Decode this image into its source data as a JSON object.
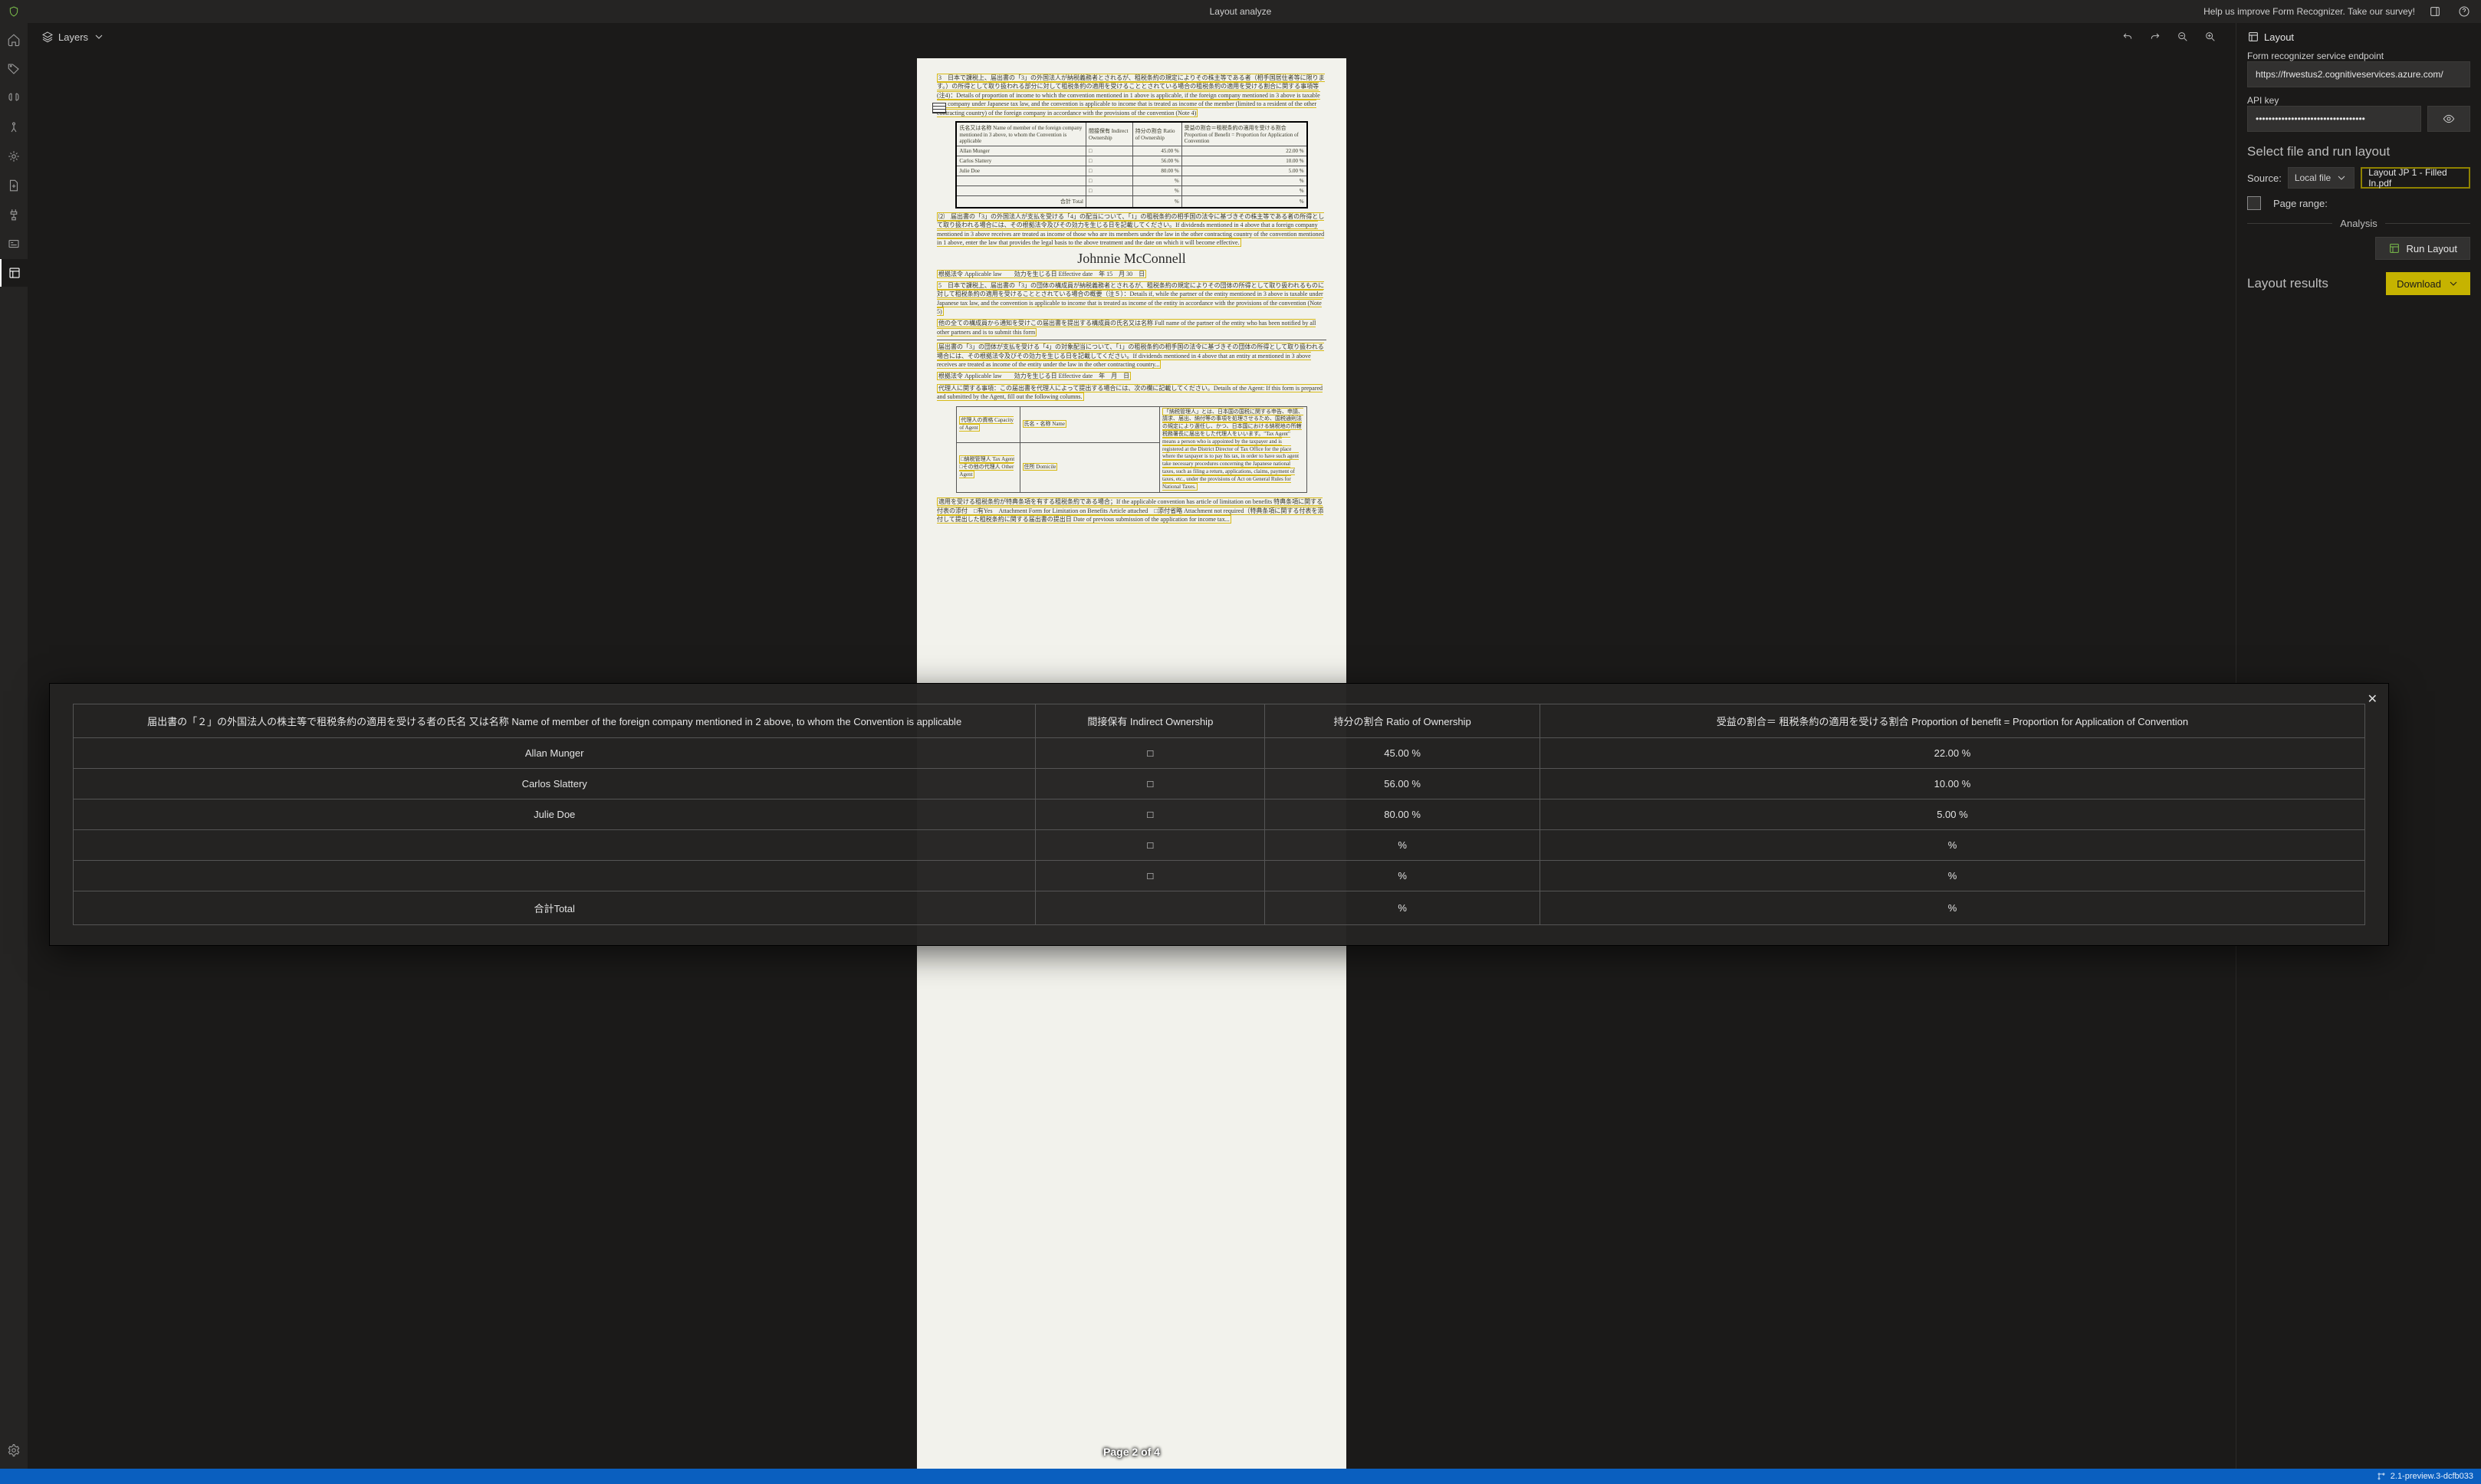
{
  "titlebar": {
    "app_title": "Layout analyze",
    "survey_link": "Help us improve Form Recognizer. Take our survey!"
  },
  "toolbar": {
    "layers_label": "Layers"
  },
  "right_panel": {
    "title": "Layout",
    "endpoint_label": "Form recognizer service endpoint",
    "endpoint_value": "https://frwestus2.cognitiveservices.azure.com/",
    "apikey_label": "API key",
    "apikey_mask": "••••••••••••••••••••••••••••••••••",
    "select_section": "Select file and run layout",
    "source_label": "Source:",
    "source_value": "Local file",
    "file_value": "Layout JP 1 - Filled In.pdf",
    "pagerange_label": "Page range:",
    "analysis_label": "Analysis",
    "run_label": "Run Layout",
    "results_label": "Layout results",
    "download_label": "Download"
  },
  "document": {
    "page_indicator": "Page 2 of 4",
    "signature": "Johnnie McConnell",
    "paragraphs": [
      "3　日本で課税上、届出書の「3」の外国法人が納税義務者とされるが、租税条約の規定によりその株主等である者（相手国居住者等に限ります。）の所得として取り扱われる部分に対して租税条約の適用を受けることとされている場合の租税条約の適用を受ける割合に関する事項等(注4)：Details of proportion of income to which the convention mentioned in 1 above is applicable, if the foreign company mentioned in 3 above is taxable as a company under Japanese tax law, and the convention is applicable to income that is treated as income of the member (limited to a resident of the other contracting country) of the foreign company in accordance with the provisions of the convention (Note 4)",
      "⑵　届出書の「3」の外国法人が支払を受ける「4」の配当について、「1」の租税条約の相手国の法令に基づきその株主等である者の所得として取り扱われる場合には、その根拠法令及びその効力を生じる日を記載してください。If dividends mentioned in 4 above that a foreign company mentioned in 3 above receives are treated as income of those who are its members under the law in the other contracting country of the convention mentioned in 1 above, enter the law that provides the legal basis to the above treatment and the date on which it will become effective.",
      "根拠法令 Applicable law　　効力を生じる日 Effective date　年 15　月 30　日",
      "5　日本で課税上、届出書の「3」の団体の構成員が納税義務者とされるが、租税条約の規定によりその団体の所得として取り扱われるものに対して租税条約の適用を受けることとされている場合の概要（注５）：Details if, while the partner of the entity mentioned in 3 above is taxable under Japanese tax law, and the convention is applicable to income that is treated as income of the entity in accordance with the provisions of the convention (Note 5)",
      "他の全ての構成員から通知を受けこの届出書を提出する構成員の氏名又は名称 Full name of the partner of the entity who has been notified by all other partners and is to submit this form",
      "届出書の「3」の団体が支払を受ける「4」の対象配当について、「1」の租税条約の相手国の法令に基づきその団体の所得として取り扱われる場合には、その根拠法令及びその効力を生じる日を記載してください。If dividends mentioned in 4 above that an entity at mentioned in 3 above receives are treated as income of the entity under the law in the other contracting country...",
      "根拠法令 Applicable law　　効力を生じる日 Effective date　年　月　日",
      "代理人に関する事項：この届出書を代理人によって提出する場合には、次の欄に記載してください。Details of the Agent: If this form is prepared and submitted by the Agent, fill out the following columns.",
      "「納税管理人」とは、日本国の国税に関する申告、申請、請求、届出、納付等の事項を処理させるため、国税通則法の規定により選任し、かつ、日本国における納税地の所轄税務署長に届出をした代理人をいいます。\"Tax Agent\" means a person who is appointed by the taxpayer and is registered at the District Director of Tax Office for the place where the taxpayer is to pay his tax, in order to have such agent take necessary procedures concerning the Japanese national taxes, such as filing a return, applications, claims, payment of taxes, etc., under the provisions of Act on General Rules for National Taxes.",
      "適用を受ける租税条約が特典条項を有する租税条約である場合；If the applicable convention has article of limitation on benefits 特典条項に関する付表の添付　□有Yes　Attachment Form for Limitation on Benefits Article attached　□添付省略 Attachment not required（特典条項に関する付表を添付して提出した租税条約に関する届出書の提出日 Date of previous submission of the application for income tax..."
    ],
    "inner_table": {
      "headers": [
        "氏名又は名称 Name of member of the foreign company mentioned in 3 above, to whom the Convention is applicable",
        "間接保有 Indirect Ownership",
        "持分の割合 Ratio of Ownership",
        "受益の割合＝租税条約の適用を受ける割合 Proportion of Benefit = Proportion for Application of Convention"
      ],
      "rows": [
        [
          "Allan Munger",
          "□",
          "45.00 %",
          "22.00 %"
        ],
        [
          "Carlos Slattery",
          "□",
          "56.00 %",
          "10.00 %"
        ],
        [
          "Julie Doe",
          "□",
          "80.00 %",
          "5.00 %"
        ],
        [
          "",
          "□",
          "%",
          "%"
        ],
        [
          "",
          "□",
          "%",
          "%"
        ],
        [
          "合計 Total",
          "",
          "%",
          "%"
        ]
      ]
    }
  },
  "modal_table": {
    "headers": [
      "届出書の「２」の外国法人の株主等で租税条約の適用を受ける者の氏名 又は名称 Name of member of the foreign company mentioned in 2 above, to whom the Convention is applicable",
      "間接保有 Indirect Ownership",
      "持分の割合 Ratio of Ownership",
      "受益の割合＝ 租税条約の適用を受ける割合 Proportion of benefit = Proportion for Application of Convention"
    ],
    "rows": [
      {
        "name": "Allan Munger",
        "indirect": "□",
        "ratio": "45.00 %",
        "benefit": "22.00 %"
      },
      {
        "name": "Carlos Slattery",
        "indirect": "□",
        "ratio": "56.00 %",
        "benefit": "10.00 %"
      },
      {
        "name": "Julie Doe",
        "indirect": "□",
        "ratio": "80.00 %",
        "benefit": "5.00 %"
      },
      {
        "name": "",
        "indirect": "□",
        "ratio": "%",
        "benefit": "%"
      },
      {
        "name": "",
        "indirect": "□",
        "ratio": "%",
        "benefit": "%"
      },
      {
        "name": "合計Total",
        "indirect": "",
        "ratio": "%",
        "benefit": "%"
      }
    ]
  },
  "statusbar": {
    "version": "2.1-preview.3-dcfb033"
  }
}
